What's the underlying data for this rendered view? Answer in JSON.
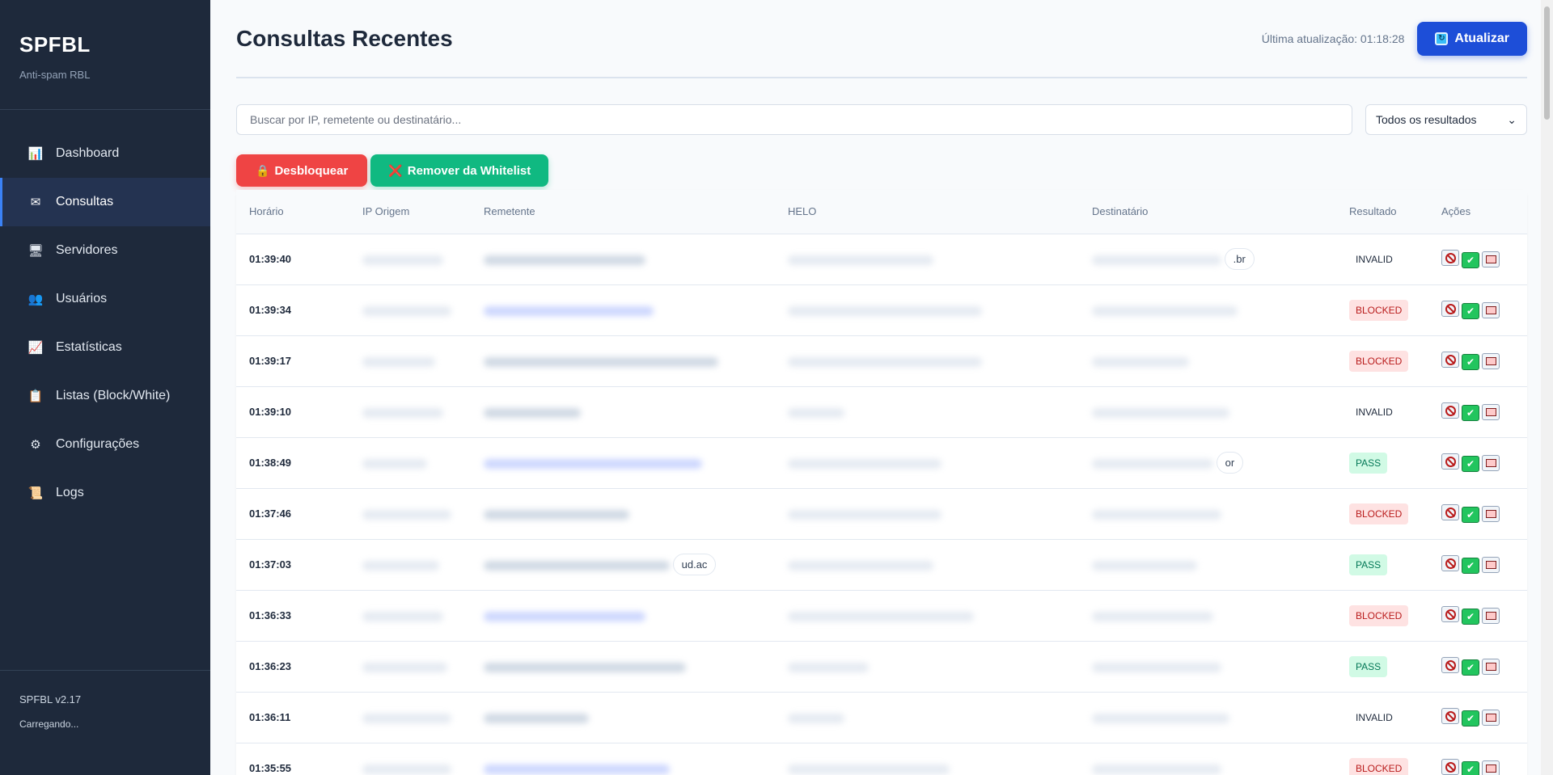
{
  "sidebar": {
    "brand": "SPFBL",
    "subtitle": "Anti-spam RBL",
    "items": [
      {
        "label": "Dashboard",
        "icon": "chart-icon"
      },
      {
        "label": "Consultas",
        "icon": "mail-icon"
      },
      {
        "label": "Servidores",
        "icon": "monitor-icon"
      },
      {
        "label": "Usuários",
        "icon": "users-icon"
      },
      {
        "label": "Estatísticas",
        "icon": "trend-icon"
      },
      {
        "label": "Listas (Block/White)",
        "icon": "clipboard-icon"
      },
      {
        "label": "Configurações",
        "icon": "gear-icon"
      },
      {
        "label": "Logs",
        "icon": "scroll-icon"
      }
    ],
    "version": "SPFBL v2.17",
    "status": "Carregando..."
  },
  "header": {
    "title": "Consultas Recentes",
    "last_update": "Última atualização: 01:18:28",
    "refresh_label": "Atualizar"
  },
  "filters": {
    "search_placeholder": "Buscar por IP, remetente ou destinatário...",
    "result_select": "Todos os resultados"
  },
  "actions": {
    "unblock_label": "Desbloquear",
    "remove_whitelist_label": "Remover da Whitelist"
  },
  "table": {
    "columns": [
      "Horário",
      "IP Origem",
      "Remetente",
      "HELO",
      "Destinatário",
      "Resultado",
      "Ações"
    ],
    "rows": [
      {
        "time": "01:39:40",
        "result": "INVALID",
        "dest_tail": ".br"
      },
      {
        "time": "01:39:34",
        "result": "BLOCKED",
        "dest_tail": ""
      },
      {
        "time": "01:39:17",
        "result": "BLOCKED",
        "dest_tail": ""
      },
      {
        "time": "01:39:10",
        "result": "INVALID",
        "dest_tail": ""
      },
      {
        "time": "01:38:49",
        "result": "PASS",
        "dest_tail": "or"
      },
      {
        "time": "01:37:46",
        "result": "BLOCKED",
        "dest_tail": ""
      },
      {
        "time": "01:37:03",
        "result": "PASS",
        "dest_tail": "",
        "sender_tail": "ud.ac"
      },
      {
        "time": "01:36:33",
        "result": "BLOCKED",
        "dest_tail": ""
      },
      {
        "time": "01:36:23",
        "result": "PASS",
        "dest_tail": ""
      },
      {
        "time": "01:36:11",
        "result": "INVALID",
        "dest_tail": ""
      },
      {
        "time": "01:35:55",
        "result": "BLOCKED",
        "dest_tail": ""
      }
    ],
    "partial_helo_last": "domnoc16mx1.segurojoia.com.br"
  }
}
